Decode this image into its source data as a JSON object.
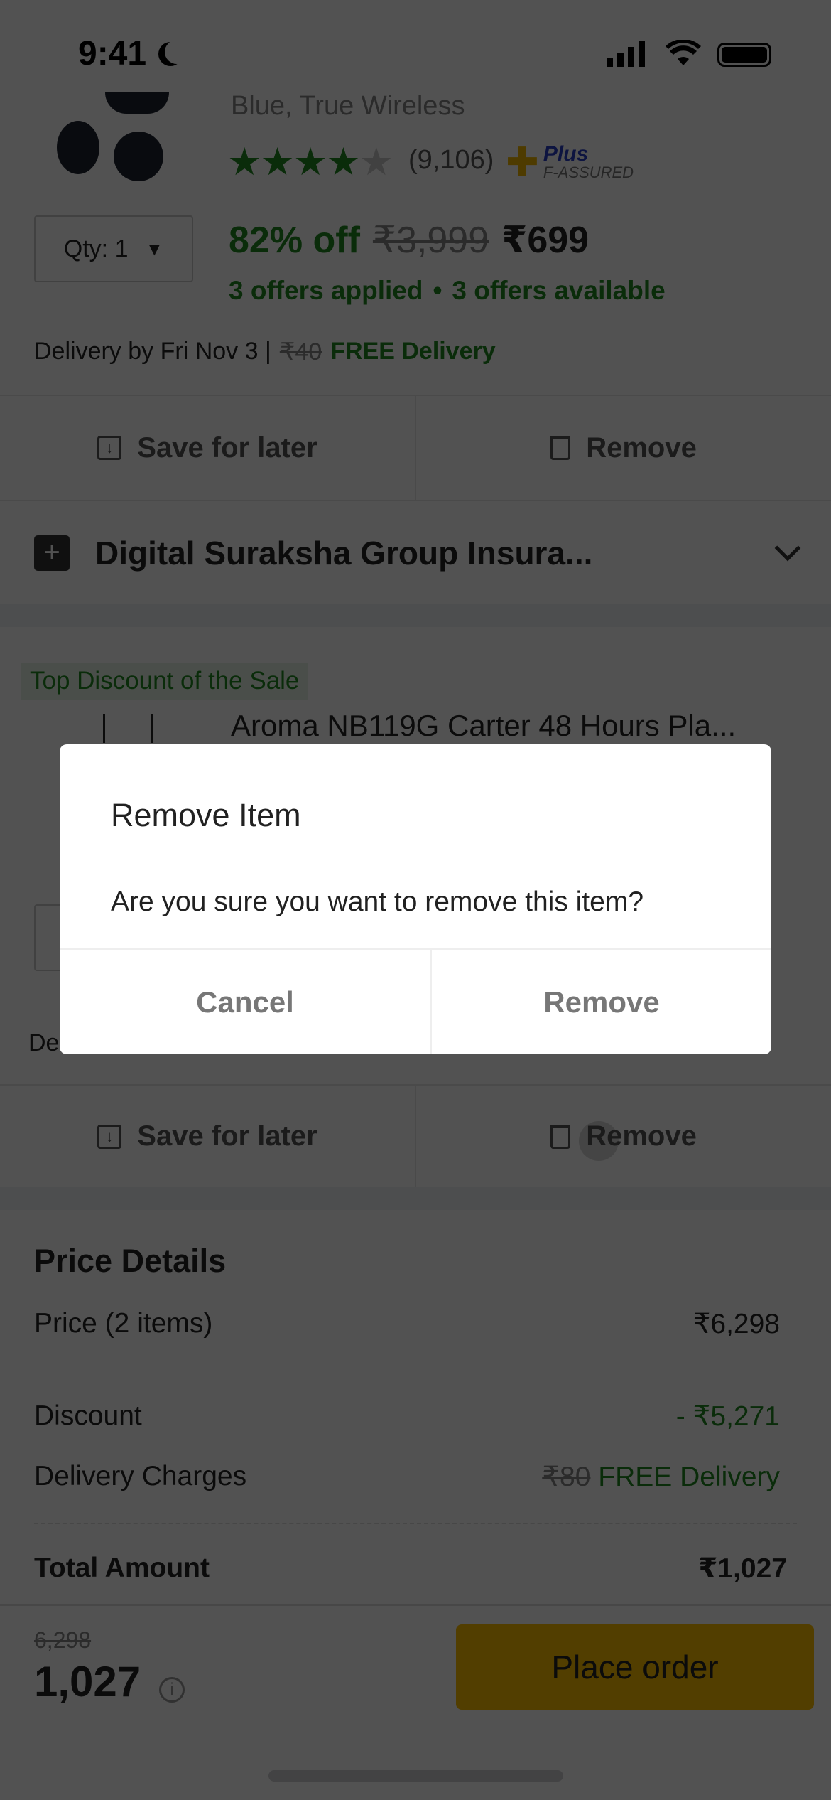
{
  "status_bar": {
    "time": "9:41"
  },
  "item1": {
    "subtitle": "Blue, True Wireless",
    "rating_count": "(9,106)",
    "assured_plus": "Plus",
    "assured_label": "F-ASSURED",
    "qty": "Qty: 1",
    "discount": "82% off",
    "mrp": "₹3,999",
    "price": "₹699",
    "offers_applied": "3 offers applied",
    "offers_sep": "•",
    "offers_available": "3 offers available",
    "delivery": "Delivery by Fri Nov 3 |",
    "delivery_old": "₹40",
    "delivery_free": "FREE Delivery",
    "rating": 4.5
  },
  "actions": {
    "save": "Save for later",
    "remove": "Remove"
  },
  "insurance": {
    "label": "Digital Suraksha Group Insura..."
  },
  "item2": {
    "badge": "Top Discount of the Sale",
    "title": "Aroma NB119G Carter 48 Hours Pla...",
    "delivery_partial": "De"
  },
  "dialog": {
    "title": "Remove Item",
    "message": "Are you sure you want to remove this item?",
    "cancel": "Cancel",
    "remove": "Remove"
  },
  "price_details": {
    "title": "Price Details",
    "rows": [
      {
        "label": "Price (2 items)",
        "value": "₹6,298"
      },
      {
        "label": "Discount",
        "value": "- ₹5,271"
      },
      {
        "label": "Delivery Charges",
        "old": "₹80",
        "value": "FREE Delivery"
      }
    ],
    "total_label": "Total Amount",
    "total_value": "₹1,027"
  },
  "bottom_bar": {
    "old_total": "6,298",
    "total": "1,027",
    "place_order": "Place order"
  },
  "colors": {
    "green": "#1f8a1f",
    "place_order": "#ffc200",
    "overlay": "rgba(0,0,0,0.68)"
  }
}
